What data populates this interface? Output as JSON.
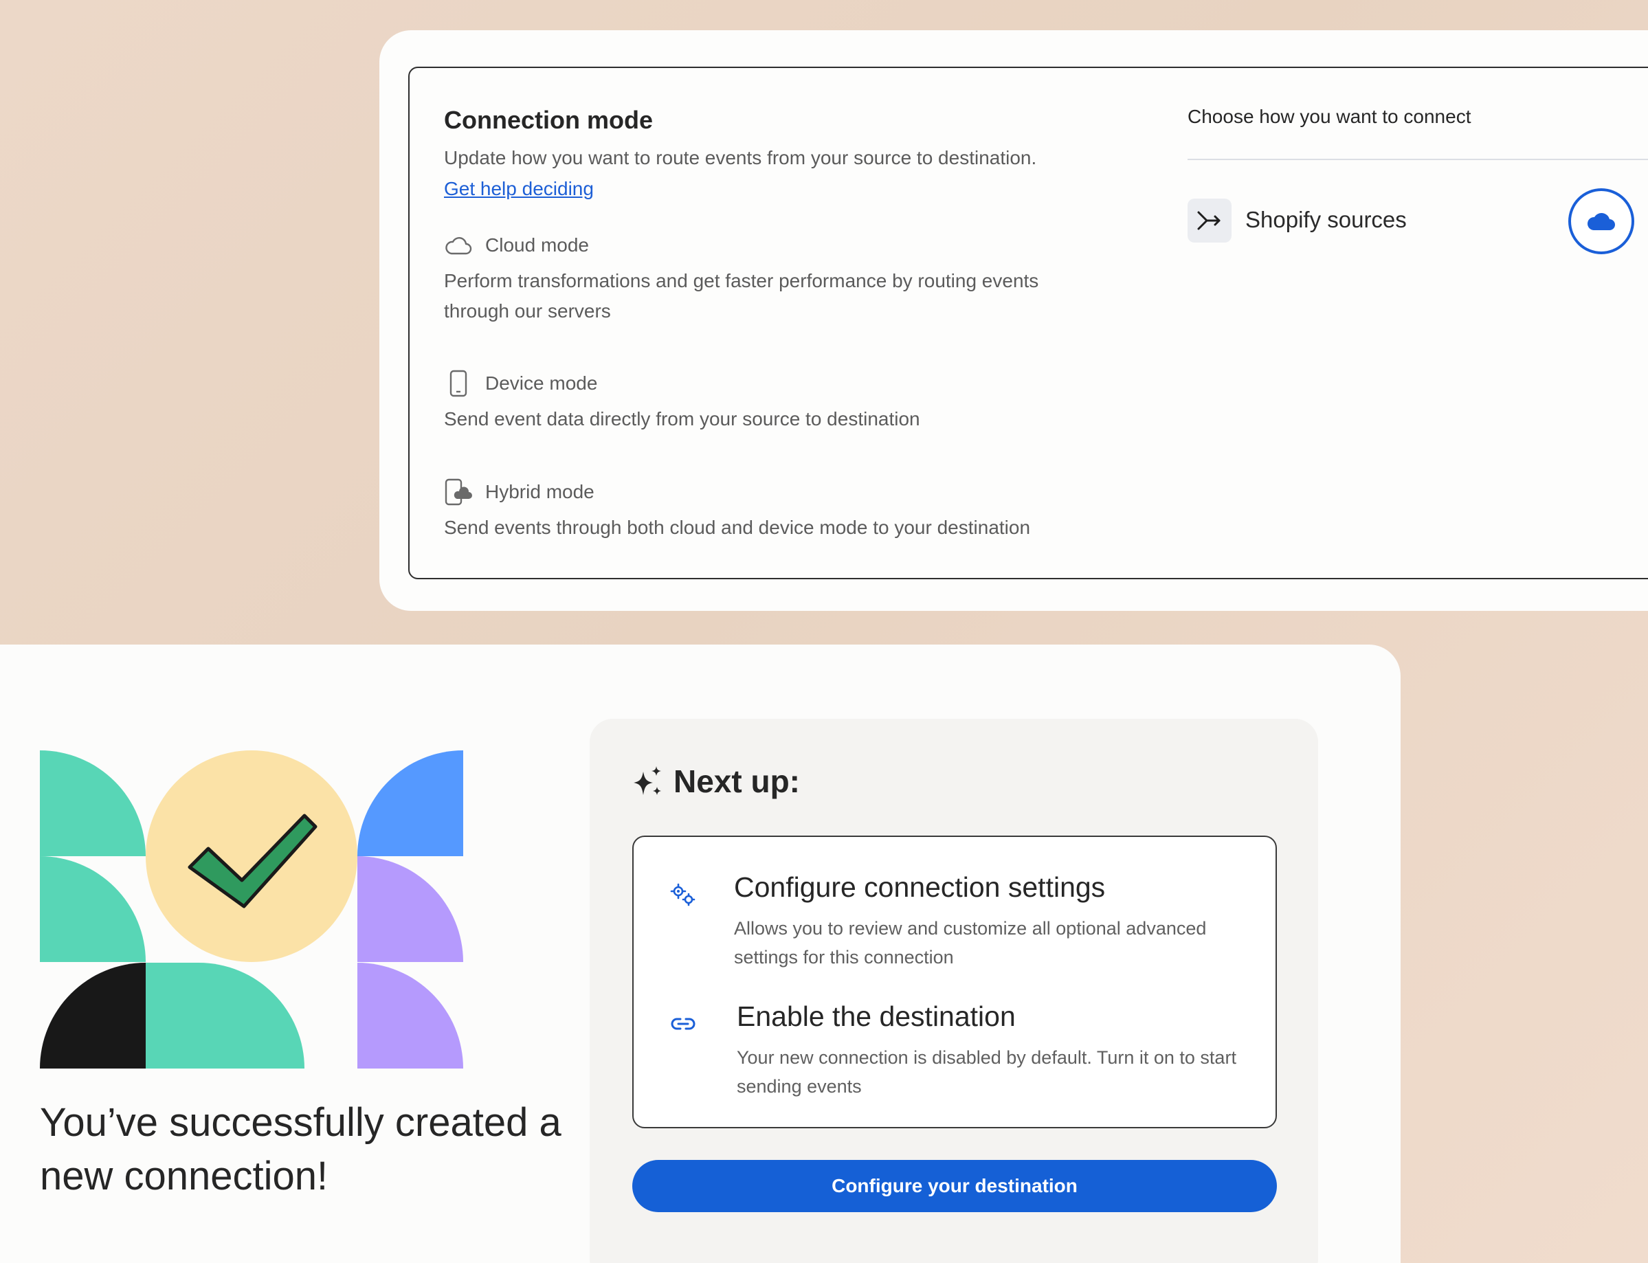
{
  "connection_mode": {
    "title": "Connection mode",
    "subtitle": "Update how you want to route events from your source to destination.",
    "help_link": "Get help deciding",
    "modes": [
      {
        "icon": "cloud-icon",
        "label": "Cloud mode",
        "description": "Perform transformations and get faster performance by routing events through our servers"
      },
      {
        "icon": "phone-icon",
        "label": "Device mode",
        "description": "Send event data directly from your source to destination"
      },
      {
        "icon": "hybrid-icon",
        "label": "Hybrid mode",
        "description": "Send events through both cloud and device mode to your destination"
      }
    ],
    "choose_title": "Choose how you want to connect",
    "source": {
      "icon": "merge-arrow-icon",
      "label": "Shopify sources",
      "selected_mode_icon": "cloud-filled-icon"
    }
  },
  "success": {
    "title": "You’ve successfully created a new connection!",
    "illustration_icon": "checkmark-icon"
  },
  "next_up": {
    "title": "Next up:",
    "icon": "sparkles-icon",
    "steps": [
      {
        "icon": "gears-icon",
        "title": "Configure connection settings",
        "description": "Allows you to review and customize all optional advanced settings for this connection"
      },
      {
        "icon": "link-icon",
        "title": "Enable the destination",
        "description": "Your new connection is disabled by default. Turn it on to start sending events"
      }
    ],
    "cta_label": "Configure your destination"
  },
  "colors": {
    "background": "#ecd8c8",
    "accent_blue": "#1560d6",
    "mint": "#58d6b6",
    "yellow": "#fbe2a7",
    "blue": "#5599ff",
    "purple": "#b59afd",
    "check_green": "#2f9a5e"
  }
}
